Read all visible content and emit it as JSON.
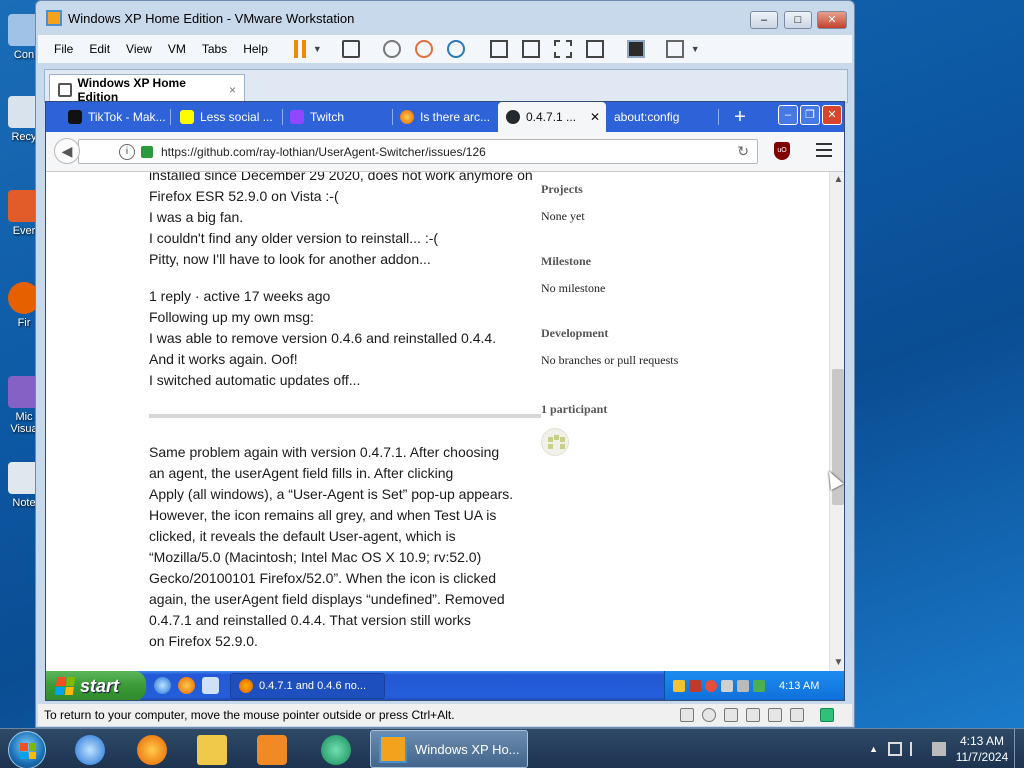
{
  "host": {
    "desktop_icons": [
      {
        "label": "Con"
      },
      {
        "label": "Recy"
      },
      {
        "label": "Ever"
      },
      {
        "label": "Fir"
      },
      {
        "label": "Mic\nVisua"
      },
      {
        "label": "Note"
      }
    ],
    "taskbar": {
      "active_window_label": "Windows XP Ho...",
      "clock_time": "4:13 AM",
      "clock_date": "11/7/2024"
    }
  },
  "vmware": {
    "title": "Windows XP Home Edition - VMware Workstation",
    "menu": [
      "File",
      "Edit",
      "View",
      "VM",
      "Tabs",
      "Help"
    ],
    "vm_tab_label": "Windows XP Home Edition",
    "vm_tab_close": "×",
    "status_text": "To return to your computer, move the mouse pointer outside or press Ctrl+Alt."
  },
  "firefox": {
    "tabs": [
      {
        "label": "TikTok - Mak...",
        "icon": "tiktok-icon",
        "color": "#111111"
      },
      {
        "label": "Less social ...",
        "icon": "snapchat-icon",
        "color": "#fffc00"
      },
      {
        "label": "Twitch",
        "icon": "twitch-icon",
        "color": "#9146ff"
      },
      {
        "label": "Is there arc...",
        "icon": "firefox-icon",
        "color": "#e66000"
      },
      {
        "label": "0.4.7.1 ...",
        "icon": "github-icon",
        "color": "#24292e",
        "active": true
      },
      {
        "label": "about:config",
        "icon": "",
        "color": ""
      }
    ],
    "new_tab_label": "+",
    "url": "https://github.com/ray-lothian/UserAgent-Switcher/issues/126",
    "ublock_label": "uO"
  },
  "page": {
    "comment1_lines": [
      "installed since December 29 2020, does not work anymore on",
      "Firefox ESR 52.9.0 on Vista :-(",
      "I was a big fan.",
      "I couldn't find any older version to reinstall... :-(",
      "Pitty, now I'll have to look for another addon..."
    ],
    "reply_meta": "1 reply · active 17 weeks ago",
    "reply_lines": [
      "Following up my own msg:",
      "I was able to remove version 0.4.6 and reinstalled 0.4.4.",
      "And it works again. Oof!",
      "I switched automatic updates off..."
    ],
    "comment2_lines": [
      "Same problem again with version 0.4.7.1. After choosing",
      "an agent, the userAgent field fills in. After clicking",
      "Apply (all windows), a “User-Agent is Set” pop-up appears.",
      "However, the icon remains all grey, and when Test UA is",
      "clicked, it reveals the default User-agent, which is",
      "“Mozilla/5.0 (Macintosh; Intel Mac OS X 10.9; rv:52.0)",
      "Gecko/20100101 Firefox/52.0”. When the icon is clicked",
      "again, the userAgent field displays “undefined”. Removed",
      "0.4.7.1 and reinstalled 0.4.4. That version still works",
      "on Firefox 52.9.0."
    ],
    "sidebar": {
      "projects_title": "Projects",
      "projects_value": "None yet",
      "milestone_title": "Milestone",
      "milestone_value": "No milestone",
      "development_title": "Development",
      "development_value": "No branches or pull requests",
      "participants_title": "1 participant"
    }
  },
  "xp": {
    "start_label": "start",
    "task_label": "0.4.7.1 and 0.4.6 no...",
    "clock": "4:13 AM"
  }
}
